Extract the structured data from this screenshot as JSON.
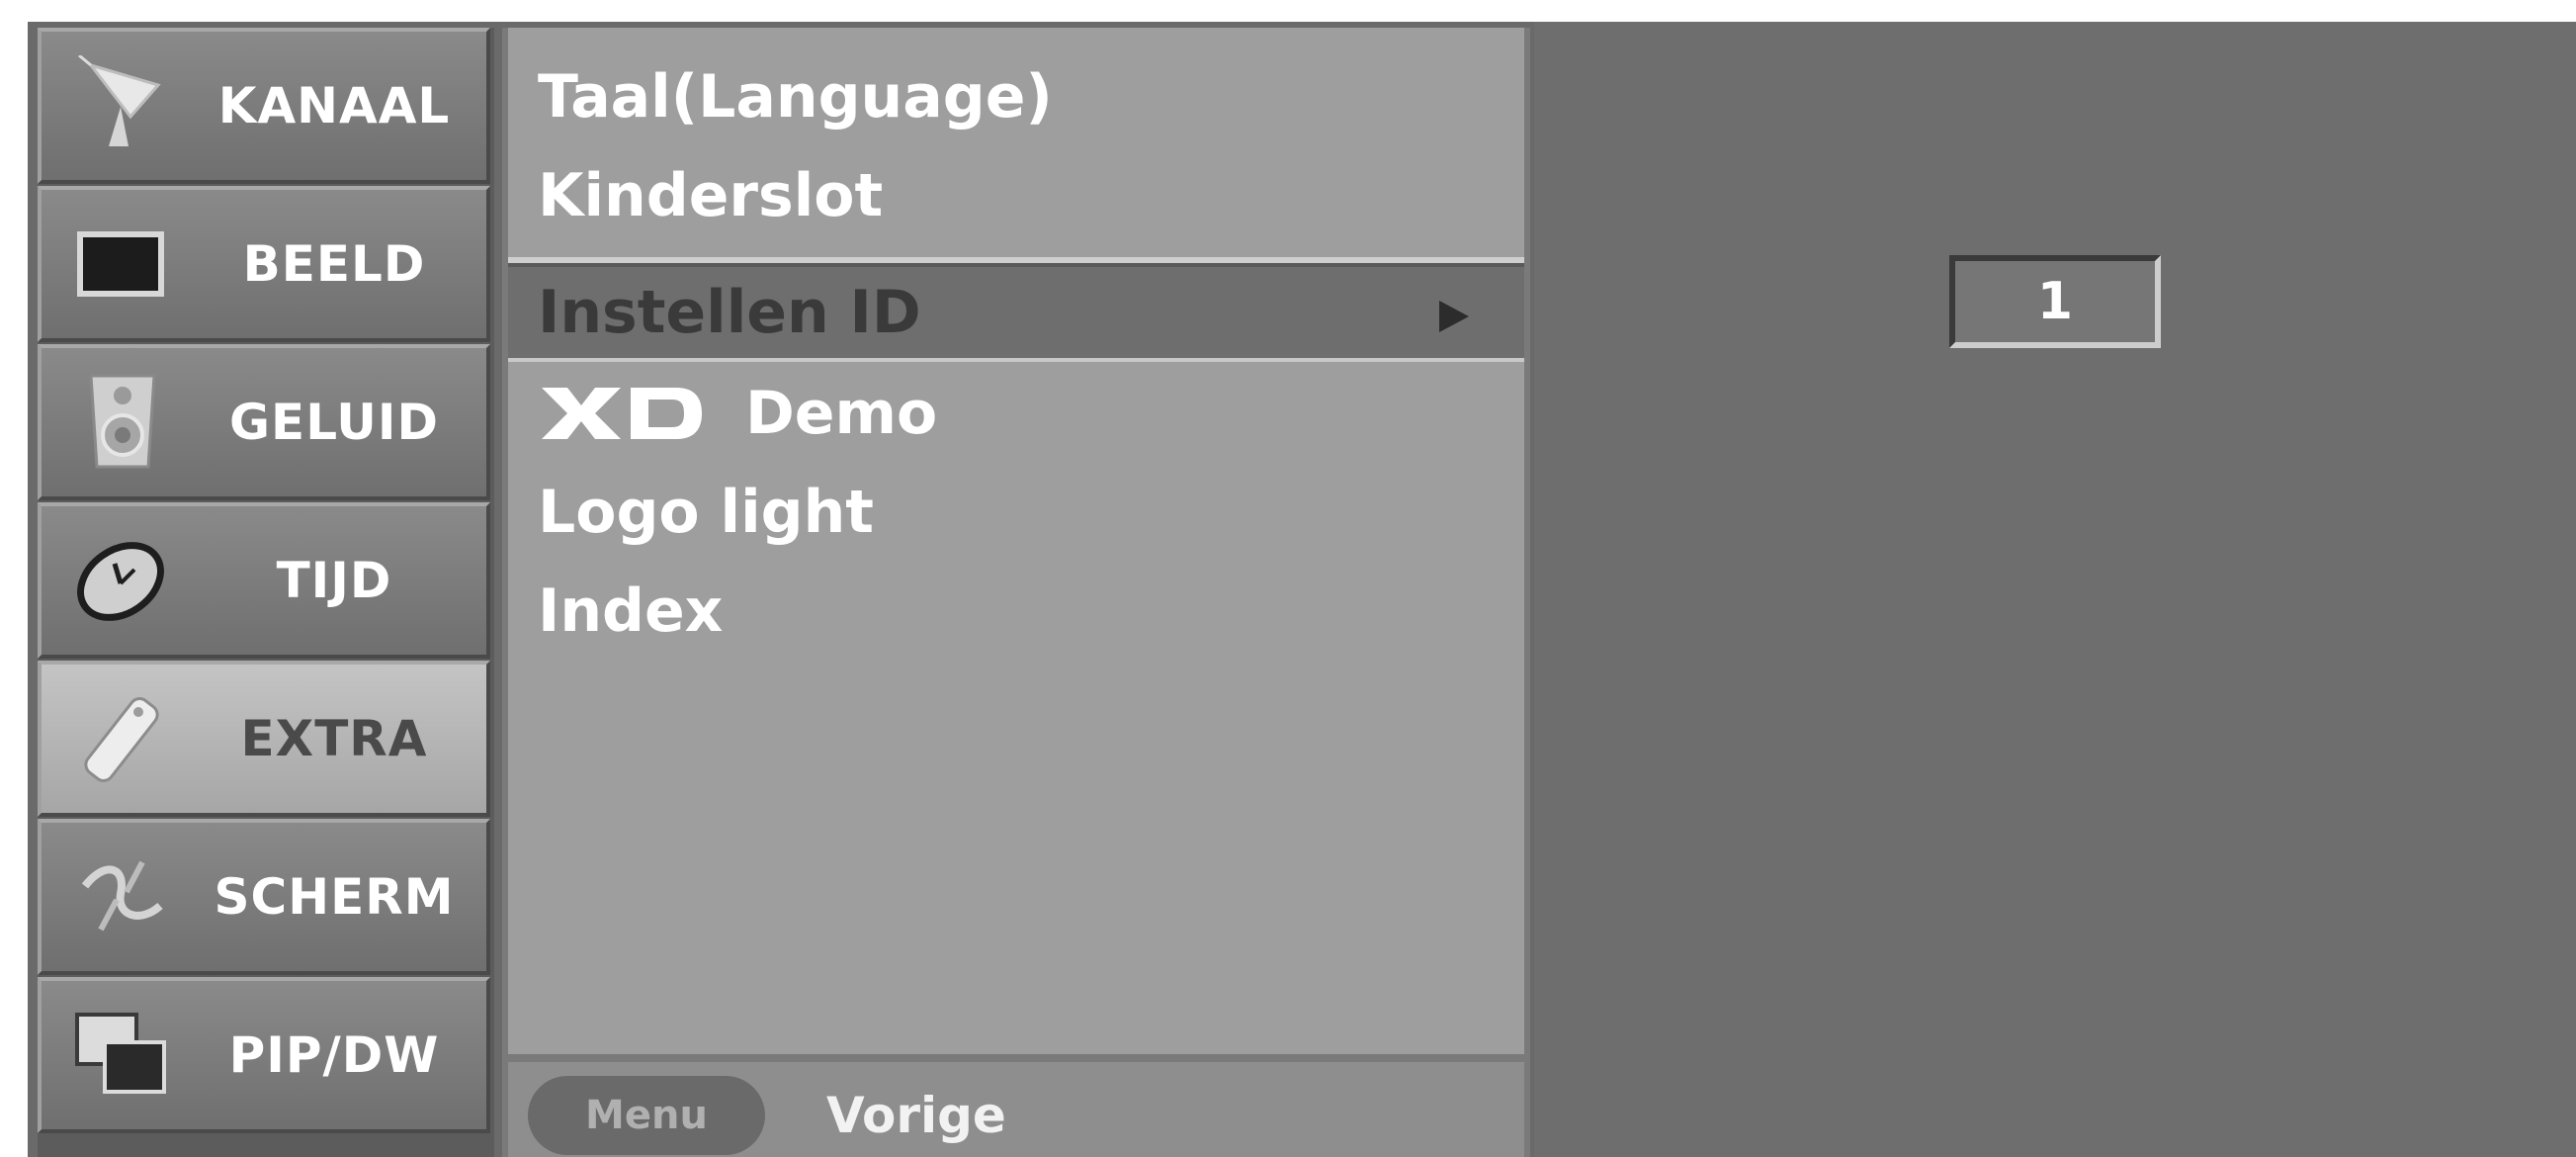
{
  "sidebar": {
    "items": [
      {
        "label": "KANAAL",
        "icon": "satellite-dish-icon"
      },
      {
        "label": "BEELD",
        "icon": "picture-screen-icon"
      },
      {
        "label": "GELUID",
        "icon": "speaker-icon"
      },
      {
        "label": "TIJD",
        "icon": "clock-icon"
      },
      {
        "label": "EXTRA",
        "icon": "remote-control-icon",
        "active": true
      },
      {
        "label": "SCHERM",
        "icon": "screen-adjust-icon"
      },
      {
        "label": "PIP/DW",
        "icon": "pip-windows-icon"
      }
    ]
  },
  "menu": {
    "items": [
      {
        "label": "Taal(Language)"
      },
      {
        "label": "Kinderslot"
      },
      {
        "label": "Instellen ID",
        "selected": true
      },
      {
        "label": "Demo",
        "logo": "XD"
      },
      {
        "label": "Logo light"
      },
      {
        "label": "Index"
      }
    ],
    "footer": {
      "menu_button": "Menu",
      "back_label": "Vorige"
    }
  },
  "value_panel": {
    "id_value": "1"
  },
  "colors": {
    "background": "#6a6a6a",
    "menu": "#9e9e9e",
    "highlight": "#6e6e6e",
    "active_category": "#b8b8b8"
  }
}
